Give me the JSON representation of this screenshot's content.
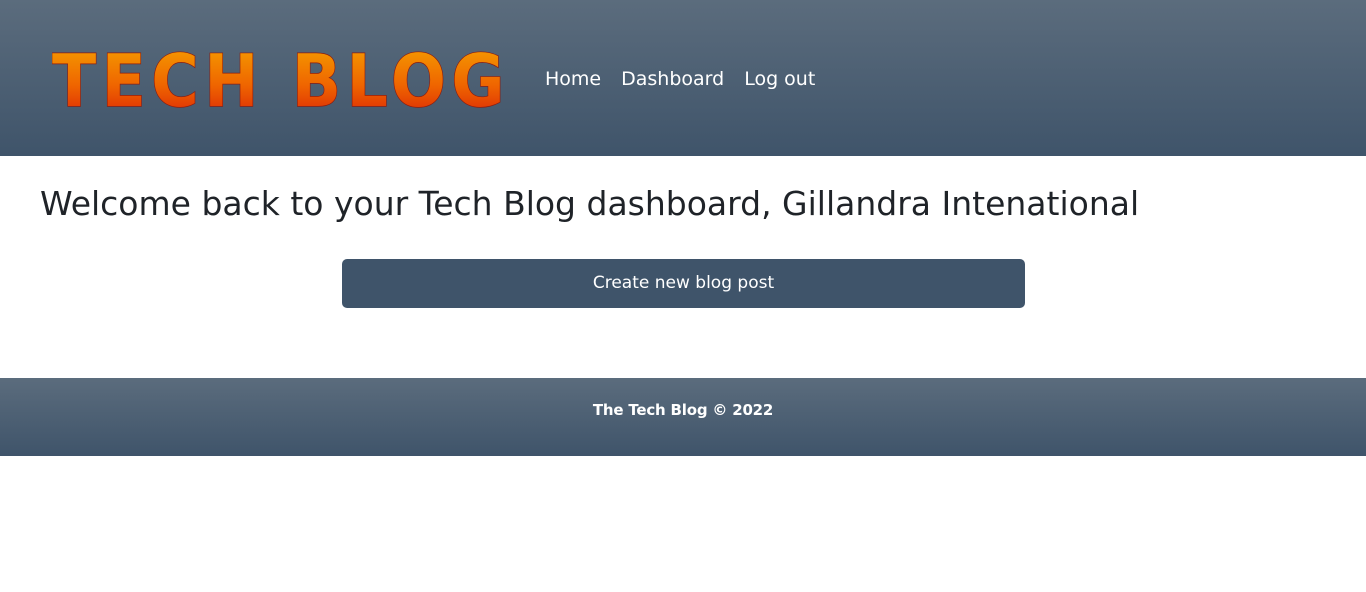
{
  "header": {
    "logo_text": "TECH BLOG",
    "nav": {
      "home_label": "Home",
      "dashboard_label": "Dashboard",
      "logout_label": "Log out"
    }
  },
  "main": {
    "welcome_text": "Welcome back to your Tech Blog dashboard, Gillandra Intenational",
    "create_post_label": "Create new blog post"
  },
  "footer": {
    "copyright_text": "The Tech Blog © 2022"
  },
  "colors": {
    "header_gradient_top": "#5b6c7d",
    "header_gradient_bottom": "#3f546a",
    "button_background": "#3f546a",
    "logo_gradient_top": "#f6a400",
    "logo_gradient_bottom": "#d91e06",
    "text_dark": "#1f2328",
    "text_light": "#ffffff"
  }
}
